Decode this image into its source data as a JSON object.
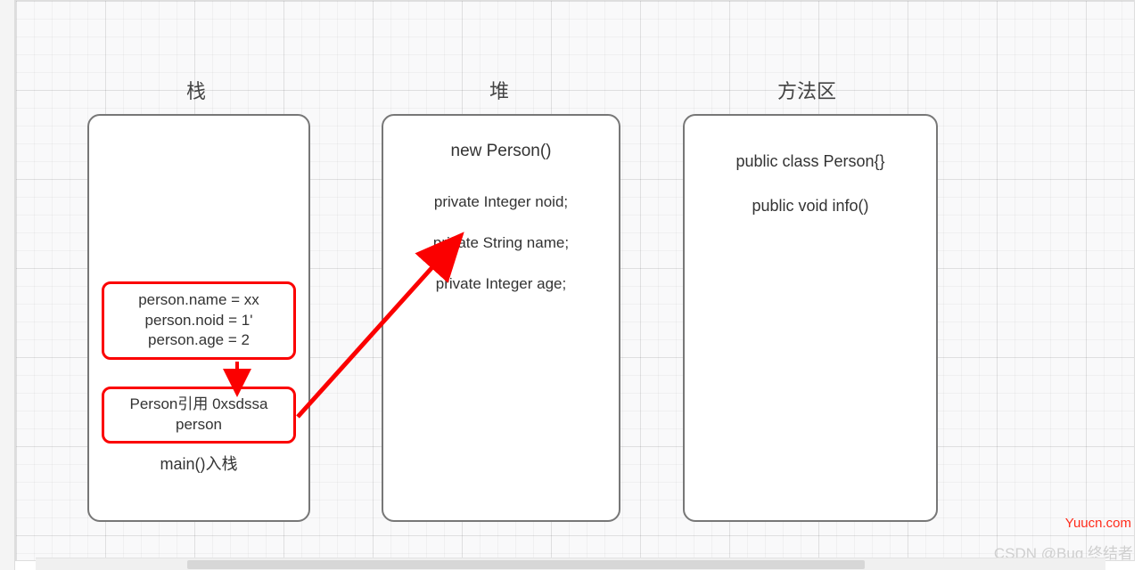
{
  "titles": {
    "stack": "栈",
    "heap": "堆",
    "method_area": "方法区"
  },
  "stack": {
    "assign_box": {
      "line1": "person.name = xx",
      "line2": "person.noid = 1'",
      "line3": "person.age = 2"
    },
    "ref_box": {
      "line1": "Person引用 0xsdssa",
      "line2": "person"
    },
    "main_label": "main()入栈"
  },
  "heap": {
    "title": "new Person()",
    "field1": "private Integer noid;",
    "field2": "private String name;",
    "field3": "private Integer age;"
  },
  "method_area": {
    "line1": "public class Person{}",
    "line2": "public void info()"
  },
  "watermarks": {
    "yuucn": "Yuucn.com",
    "csdn": "CSDN @Bug 终结者"
  },
  "colors": {
    "red": "#fb0000",
    "box_border": "#777777"
  }
}
